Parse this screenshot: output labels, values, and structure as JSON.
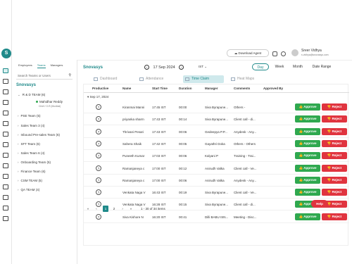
{
  "brand": {
    "logo_letter": "S",
    "logo_sub": "ntr"
  },
  "nav": {
    "icons": [
      "home-icon",
      "grid-icon",
      "monitor-icon",
      "mail-icon",
      "desktop-icon",
      "chart-icon",
      "map-icon",
      "briefcase-icon",
      "users-icon",
      "clipboard-icon",
      "calendar-icon",
      "timer-icon",
      "message-icon",
      "cloud-icon",
      "group-icon"
    ]
  },
  "panel": {
    "tabs": [
      "Employees",
      "Teams",
      "Managers"
    ],
    "active_tab": "Teams",
    "search_placeholder": "Search Teams or Users",
    "org": "Snovasys",
    "teams": [
      {
        "name": "R & D TEAM",
        "count": "(6)",
        "expanded": true
      },
      {
        "name": "PSE Team",
        "count": "(5)"
      },
      {
        "name": "Sales Team 3",
        "count": "(4)"
      },
      {
        "name": "Inbound Pre-sales Team",
        "count": "(6)"
      },
      {
        "name": "SFT Team",
        "count": "(6)"
      },
      {
        "name": "Sales Team 6",
        "count": "(4)"
      },
      {
        "name": "Onboarding Team",
        "count": "(5)"
      },
      {
        "name": "Finance Team",
        "count": "(6)"
      },
      {
        "name": "CSM TEAM",
        "count": "(5)"
      },
      {
        "name": "QA TEAM",
        "count": "(4)"
      }
    ],
    "member": {
      "name": "Mahidhar Reddy",
      "sub": "Chief / O-R (Monibal)"
    }
  },
  "topbar": {
    "download": "Download Agent",
    "user_name": "Sreer Vidhya",
    "user_email": "s.vidhya@snovasys.com"
  },
  "main": {
    "crumb": "Snovasys",
    "date": "17 Sep 2024",
    "timezone": "IST",
    "periods": [
      "Day",
      "Week",
      "Month",
      "Date Range"
    ],
    "active_period": "Day",
    "tabs": [
      "Dashboard",
      "Attendance",
      "Time Claim",
      "Heat Maps"
    ],
    "active_tab": "Time Claim",
    "headers": [
      "Productive",
      "Name",
      "Start Time",
      "Duration",
      "Manager",
      "Comments",
      "Approved By"
    ],
    "group_label": "Sep 17, 2024",
    "rows": [
      {
        "name": "Kiranmai Manni",
        "start": "17:45 IST",
        "duration": "00:00",
        "manager": "Siva Byrapune...",
        "comments": "Others -"
      },
      {
        "name": "priyanka sharm",
        "start": "17:43 IST",
        "duration": "00:14",
        "manager": "Siva Byrapune...",
        "comments": "Client call - di..."
      },
      {
        "name": "Thrivani Pesari",
        "start": "17:43 IST",
        "duration": "00:06",
        "manager": "Gedeepya P.P...",
        "comments": "Anydesk - Any..."
      },
      {
        "name": "Sahera Shaik",
        "start": "17:42 IST",
        "duration": "00:05",
        "manager": "Gayathri Doka",
        "comments": "Others - Others"
      },
      {
        "name": "Puneeth Kumar",
        "start": "17:03 IST",
        "duration": "00:06",
        "manager": "Kalyani P",
        "comments": "Training - Trai..."
      },
      {
        "name": "Ramanjaneya c",
        "start": "17:00 IST",
        "duration": "00:12",
        "manager": "Anirudh Valka",
        "comments": "Client call - Ve..."
      },
      {
        "name": "Ramanjaneya c",
        "start": "17:00 IST",
        "duration": "00:06",
        "manager": "Anirudh Valka",
        "comments": "Anydesk - Any..."
      },
      {
        "name": "Venkata Naga V",
        "start": "16:43 IST",
        "duration": "00:19",
        "manager": "Siva Byrapune...",
        "comments": "Client call - Ve..."
      },
      {
        "name": "Venkata Naga V",
        "start": "16:28 IST",
        "duration": "00:15",
        "manager": "Siva Byrapune...",
        "comments": "Client call - di..."
      },
      {
        "name": "Siva Kishore N",
        "start": "16:20 IST",
        "duration": "00:41",
        "manager": "Dilli BABU ISN...",
        "comments": "Meeting - Disc..."
      }
    ],
    "approve_label": "Approve",
    "reject_label": "Reject",
    "pagination": {
      "pages": [
        "1",
        "2"
      ],
      "active": "1",
      "summary": "1 - 30 of 34 items"
    },
    "help": "Help"
  },
  "colors": {
    "accent": "#1f8a8a",
    "approve": "#2fa84f",
    "reject": "#e0343f"
  }
}
